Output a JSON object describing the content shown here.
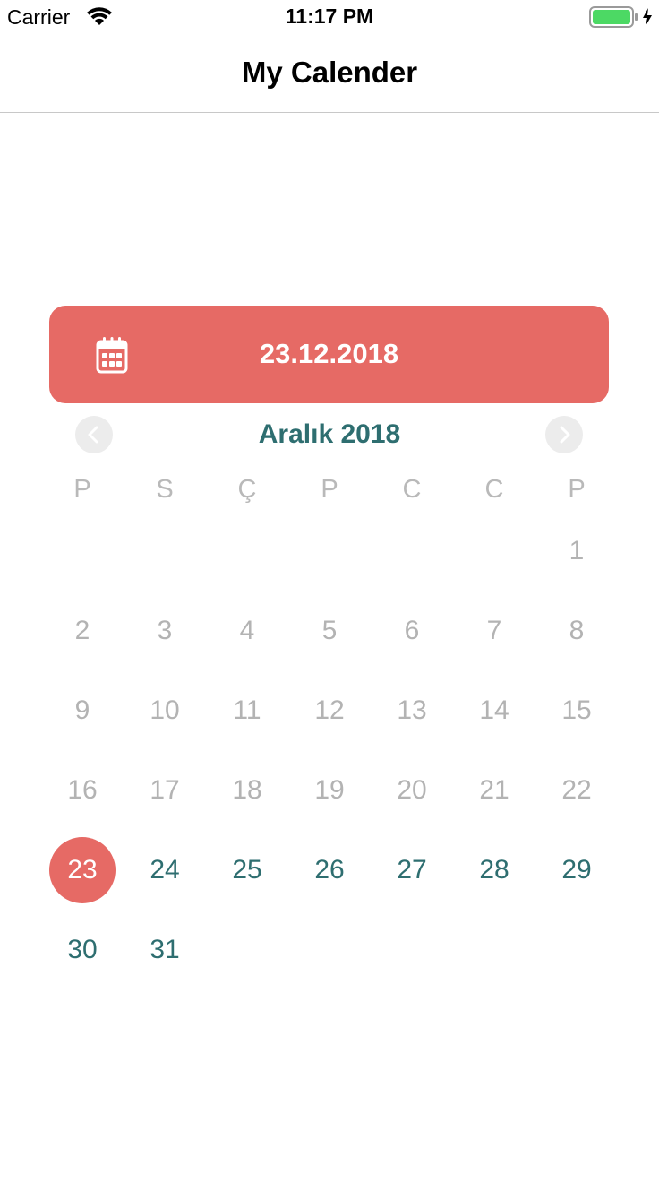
{
  "status_bar": {
    "carrier": "Carrier",
    "time": "11:17 PM",
    "battery_color": "#4cd964"
  },
  "nav": {
    "title": "My Calender"
  },
  "banner": {
    "date": "23.12.2018",
    "background": "#e66a65",
    "icon": "calendar-icon"
  },
  "calendar": {
    "month_title": "Aralık 2018",
    "accent_color": "#2e6e70",
    "selected_color": "#e66a65",
    "weekdays": [
      "P",
      "S",
      "Ç",
      "P",
      "C",
      "C",
      "P"
    ],
    "leading_blank_days": 6,
    "days": [
      {
        "label": "1",
        "state": "past"
      },
      {
        "label": "2",
        "state": "past"
      },
      {
        "label": "3",
        "state": "past"
      },
      {
        "label": "4",
        "state": "past"
      },
      {
        "label": "5",
        "state": "past"
      },
      {
        "label": "6",
        "state": "past"
      },
      {
        "label": "7",
        "state": "past"
      },
      {
        "label": "8",
        "state": "past"
      },
      {
        "label": "9",
        "state": "past"
      },
      {
        "label": "10",
        "state": "past"
      },
      {
        "label": "11",
        "state": "past"
      },
      {
        "label": "12",
        "state": "past"
      },
      {
        "label": "13",
        "state": "past"
      },
      {
        "label": "14",
        "state": "past"
      },
      {
        "label": "15",
        "state": "past"
      },
      {
        "label": "16",
        "state": "past"
      },
      {
        "label": "17",
        "state": "past"
      },
      {
        "label": "18",
        "state": "past"
      },
      {
        "label": "19",
        "state": "past"
      },
      {
        "label": "20",
        "state": "past"
      },
      {
        "label": "21",
        "state": "past"
      },
      {
        "label": "22",
        "state": "past"
      },
      {
        "label": "23",
        "state": "selected"
      },
      {
        "label": "24",
        "state": "future"
      },
      {
        "label": "25",
        "state": "future"
      },
      {
        "label": "26",
        "state": "future"
      },
      {
        "label": "27",
        "state": "future"
      },
      {
        "label": "28",
        "state": "future"
      },
      {
        "label": "29",
        "state": "future"
      },
      {
        "label": "30",
        "state": "future"
      },
      {
        "label": "31",
        "state": "future"
      }
    ]
  }
}
